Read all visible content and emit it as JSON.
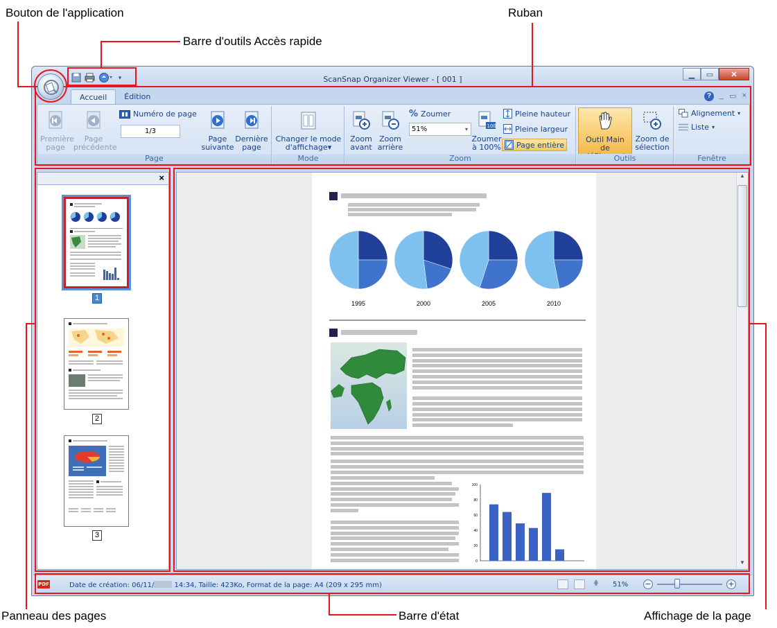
{
  "callouts": {
    "app_button": "Bouton de l'application",
    "qat": "Barre d'outils Accès rapide",
    "ribbon": "Ruban",
    "pages_pane": "Panneau des pages",
    "status_bar": "Barre d'état",
    "page_view": "Affichage de la page"
  },
  "window": {
    "title": "ScanSnap Organizer Viewer - [ 001 ]",
    "tabs": [
      {
        "label": "Accueil",
        "active": true
      },
      {
        "label": "Édition",
        "active": false
      }
    ]
  },
  "ribbon": {
    "page_group": {
      "label": "Page",
      "first_page": [
        "Première",
        "page"
      ],
      "prev_page": [
        "Page",
        "précédente"
      ],
      "page_number_label": "Numéro de page",
      "page_number_value": "1/3",
      "next_page": [
        "Page",
        "suivante"
      ],
      "last_page": [
        "Dernière",
        "page"
      ]
    },
    "mode_group": {
      "label": "Mode",
      "change_mode": [
        "Changer le mode",
        "d'affichage"
      ]
    },
    "zoom_group": {
      "label": "Zoom",
      "zoom_in": [
        "Zoom",
        "avant"
      ],
      "zoom_out": [
        "Zoom",
        "arrière"
      ],
      "zoom_label": "Zoumer",
      "zoom_value": "51%",
      "zoom_100": [
        "Zoumer",
        "à 100%"
      ],
      "full_height": "Pleine hauteur",
      "full_width": "Pleine largeur",
      "whole_page": "Page entière"
    },
    "tools_group": {
      "label": "Outils",
      "hand_tool": [
        "Outil Main",
        "de défilement"
      ],
      "selection_zoom": [
        "Zoom de",
        "sélection"
      ]
    },
    "window_group": {
      "label": "Fenêtre",
      "alignment": "Alignement",
      "list": "Liste"
    }
  },
  "pages_pane": {
    "close_glyph": "×",
    "pages": [
      "1",
      "2",
      "3"
    ],
    "selected_page": "1"
  },
  "document": {
    "pie_years": [
      "1995",
      "2000",
      "2005",
      "2010"
    ],
    "bar_axis_ticks": [
      "100",
      "80",
      "60",
      "40",
      "20",
      "0"
    ],
    "bar_values": [
      74,
      64,
      49,
      43,
      89,
      15
    ]
  },
  "status_bar": {
    "text_prefix": "Date de création: 06/11/",
    "text_suffix": " 14:34, Taille: 423Ko, Format de la page: A4 (209 x 295 mm)",
    "badge": "PDF",
    "zoom": "51%"
  },
  "colors": {
    "annotation_red": "#e8141a",
    "pie_dark": "#20409a",
    "pie_mid": "#3f73cc",
    "pie_light": "#7ec0ee",
    "bar_blue": "#3b63c4"
  }
}
